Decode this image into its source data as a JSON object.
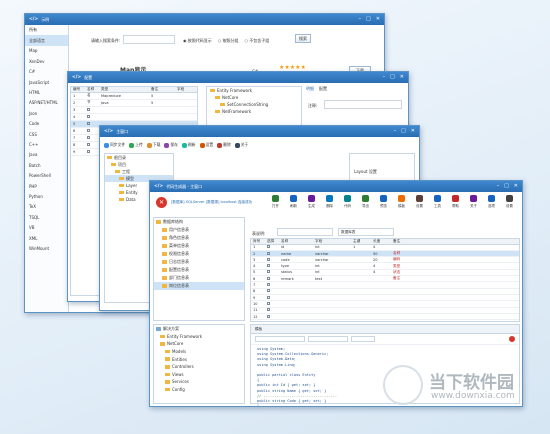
{
  "windows": [
    {
      "title": "示例",
      "sidebar": [
        "所有",
        "全部语言",
        "Map",
        "XenDev",
        "C#",
        "JavaScript",
        "HTML",
        "ASP.NET/HTML",
        "Json",
        "Code",
        "CSS",
        "C++",
        "Java",
        "Batch",
        "PowerShell",
        "PHP",
        "Python",
        "TeX",
        "TSQL",
        "VB",
        "XML",
        "WinMount"
      ],
      "search_label": "请输入搜索条件:",
      "radio_labels": [
        "按照代码显示",
        "按照分组",
        "不包含子组"
      ],
      "search_button": "搜索",
      "heading": "Map显示",
      "stars": "★★★★★",
      "c_label": "C#",
      "download": "下载",
      "status": "显示结果: 1"
    },
    {
      "title": "配置",
      "columns": [
        "编号",
        "名称",
        "类型",
        "备注",
        "字段"
      ],
      "rows": [
        [
          "1",
          "名",
          "Mapreduce",
          "5",
          ""
        ],
        [
          "2",
          "节",
          "Java",
          "5",
          ""
        ],
        [
          "3",
          "",
          "",
          "",
          ""
        ],
        [
          "4",
          "",
          "",
          "",
          ""
        ],
        [
          "5",
          "",
          "",
          "",
          ""
        ],
        [
          "6",
          "",
          "",
          "",
          ""
        ],
        [
          "7",
          "",
          "",
          "",
          ""
        ],
        [
          "8",
          "",
          "",
          "",
          ""
        ],
        [
          "9",
          "",
          "",
          "",
          ""
        ]
      ],
      "tree": [
        "Entity Framework",
        "NetCore",
        "SetConnectionString",
        "NetFramework"
      ],
      "tabs": [
        "明细",
        "配置"
      ],
      "note_label": "注释:"
    },
    {
      "title": "主窗口",
      "toolbar": [
        "同步文件",
        "上传",
        "下载",
        "保存",
        "刷新",
        "设置",
        "删除",
        "关于"
      ],
      "tree": [
        "根目录",
        "项目",
        "工程",
        "模型",
        "Layer",
        "Entity",
        "Data"
      ],
      "right_label": "Layout 设置"
    },
    {
      "title": "代码生成器 - 主窗口",
      "info": "[数据库] SQLServer [数据源] localhost 连接成功",
      "toolbar": [
        "打开",
        "刷新",
        "生成",
        "删除",
        "代码",
        "导出",
        "预览",
        "模板",
        "设置",
        "工具",
        "帮助",
        "关于",
        "选项",
        "设置"
      ],
      "left_tree": [
        "数据库结构",
        "用户信息表",
        "角色信息表",
        "菜单信息表",
        "权限信息表",
        "日志信息表",
        "配置信息表",
        "部门信息表",
        "岗位信息表"
      ],
      "table_label": "表说明:",
      "table_value": "数据库表",
      "grid_columns": [
        "序号",
        "选择",
        "名称",
        "字段",
        "主键",
        "长度",
        "备注"
      ],
      "grid_rows": [
        [
          "1",
          "",
          "id",
          "int",
          "1",
          "4",
          ""
        ],
        [
          "2",
          "",
          "name",
          "varchar",
          "",
          "50",
          "名称"
        ],
        [
          "3",
          "",
          "code",
          "varchar",
          "",
          "20",
          "编码"
        ],
        [
          "4",
          "",
          "type",
          "int",
          "",
          "4",
          "类型"
        ],
        [
          "5",
          "",
          "status",
          "int",
          "",
          "4",
          "状态"
        ],
        [
          "6",
          "",
          "remark",
          "text",
          "",
          "",
          "备注"
        ],
        [
          "7",
          "",
          "",
          "",
          "",
          "",
          ""
        ],
        [
          "8",
          "",
          "",
          "",
          "",
          "",
          ""
        ],
        [
          "9",
          "",
          "",
          "",
          "",
          "",
          ""
        ],
        [
          "10",
          "",
          "",
          "",
          "",
          "",
          ""
        ],
        [
          "11",
          "",
          "",
          "",
          "",
          "",
          ""
        ],
        [
          "12",
          "",
          "",
          "",
          "",
          "",
          ""
        ]
      ],
      "lower_tree": [
        "解决方案",
        "Entity Framework",
        "NetCore",
        "Models",
        "Entities",
        "Controllers",
        "Views",
        "Services",
        "Config"
      ],
      "editor_tab": "模板",
      "code_lines": [
        "using System;",
        "using System.Collections.Generic;",
        "using System.Data;",
        "using System.Linq;",
        "",
        "public partial class Entity",
        "{",
        "    public int Id { get; set; }",
        "    public string Name { get; set; }",
        "    // ----------------------------------",
        "    public string Code { get; set; }",
        "}"
      ]
    }
  ],
  "watermark": {
    "brand": "当下软件园",
    "url": "www.downxia.com"
  },
  "colors": {
    "titlebar": "#2f77bd",
    "folder": "#f0b63d",
    "selection": "#cfe3f7"
  }
}
